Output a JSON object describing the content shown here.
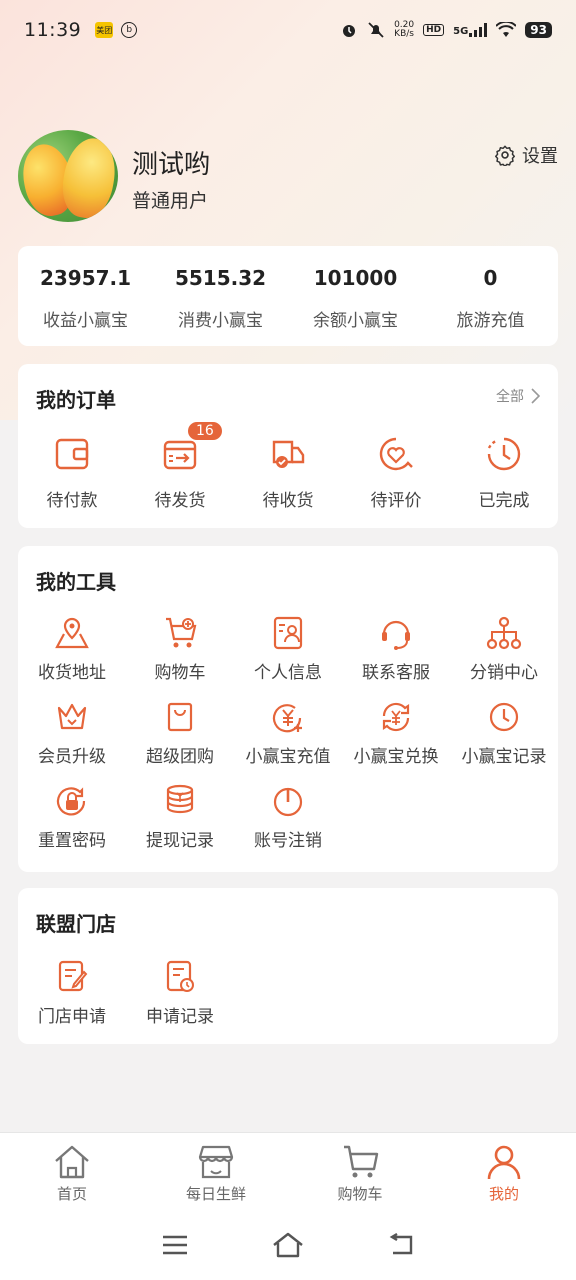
{
  "status_bar": {
    "time": "11:39",
    "speed_top": "0.20",
    "speed_bottom": "KB/s",
    "hd": "HD",
    "network": "5G",
    "battery": "93"
  },
  "profile": {
    "name": "测试哟",
    "type": "普通用户",
    "settings_label": "设置"
  },
  "stats": [
    {
      "value": "23957.1",
      "label": "收益小赢宝"
    },
    {
      "value": "5515.32",
      "label": "消费小赢宝"
    },
    {
      "value": "101000",
      "label": "余额小赢宝"
    },
    {
      "value": "0",
      "label": "旅游充值"
    }
  ],
  "orders": {
    "title": "我的订单",
    "all_label": "全部",
    "items": [
      {
        "label": "待付款",
        "icon": "wallet-icon"
      },
      {
        "label": "待发货",
        "icon": "ship-box-icon",
        "badge": "16"
      },
      {
        "label": "待收货",
        "icon": "truck-icon"
      },
      {
        "label": "待评价",
        "icon": "review-heart-icon"
      },
      {
        "label": "已完成",
        "icon": "clock-done-icon"
      }
    ]
  },
  "tools": {
    "title": "我的工具",
    "items": [
      {
        "label": "收货地址",
        "icon": "map-pin-icon"
      },
      {
        "label": "购物车",
        "icon": "cart-icon"
      },
      {
        "label": "个人信息",
        "icon": "profile-card-icon"
      },
      {
        "label": "联系客服",
        "icon": "headset-icon"
      },
      {
        "label": "分销中心",
        "icon": "network-icon"
      },
      {
        "label": "会员升级",
        "icon": "crown-icon"
      },
      {
        "label": "超级团购",
        "icon": "bag-icon"
      },
      {
        "label": "小赢宝充值",
        "icon": "yuan-recharge-icon"
      },
      {
        "label": "小赢宝兑换",
        "icon": "yuan-exchange-icon"
      },
      {
        "label": "小赢宝记录",
        "icon": "clock-record-icon"
      },
      {
        "label": "重置密码",
        "icon": "lock-reset-icon"
      },
      {
        "label": "提现记录",
        "icon": "coins-icon"
      },
      {
        "label": "账号注销",
        "icon": "power-icon"
      }
    ]
  },
  "stores": {
    "title": "联盟门店",
    "items": [
      {
        "label": "门店申请",
        "icon": "edit-doc-icon"
      },
      {
        "label": "申请记录",
        "icon": "doc-clock-icon"
      }
    ]
  },
  "bottom_nav": [
    {
      "label": "首页",
      "icon": "home-icon"
    },
    {
      "label": "每日生鲜",
      "icon": "store-icon"
    },
    {
      "label": "购物车",
      "icon": "cart-nav-icon"
    },
    {
      "label": "我的",
      "icon": "user-icon",
      "active": true
    }
  ],
  "colors": {
    "accent": "#e5653a",
    "background": "#f3f2f2"
  }
}
